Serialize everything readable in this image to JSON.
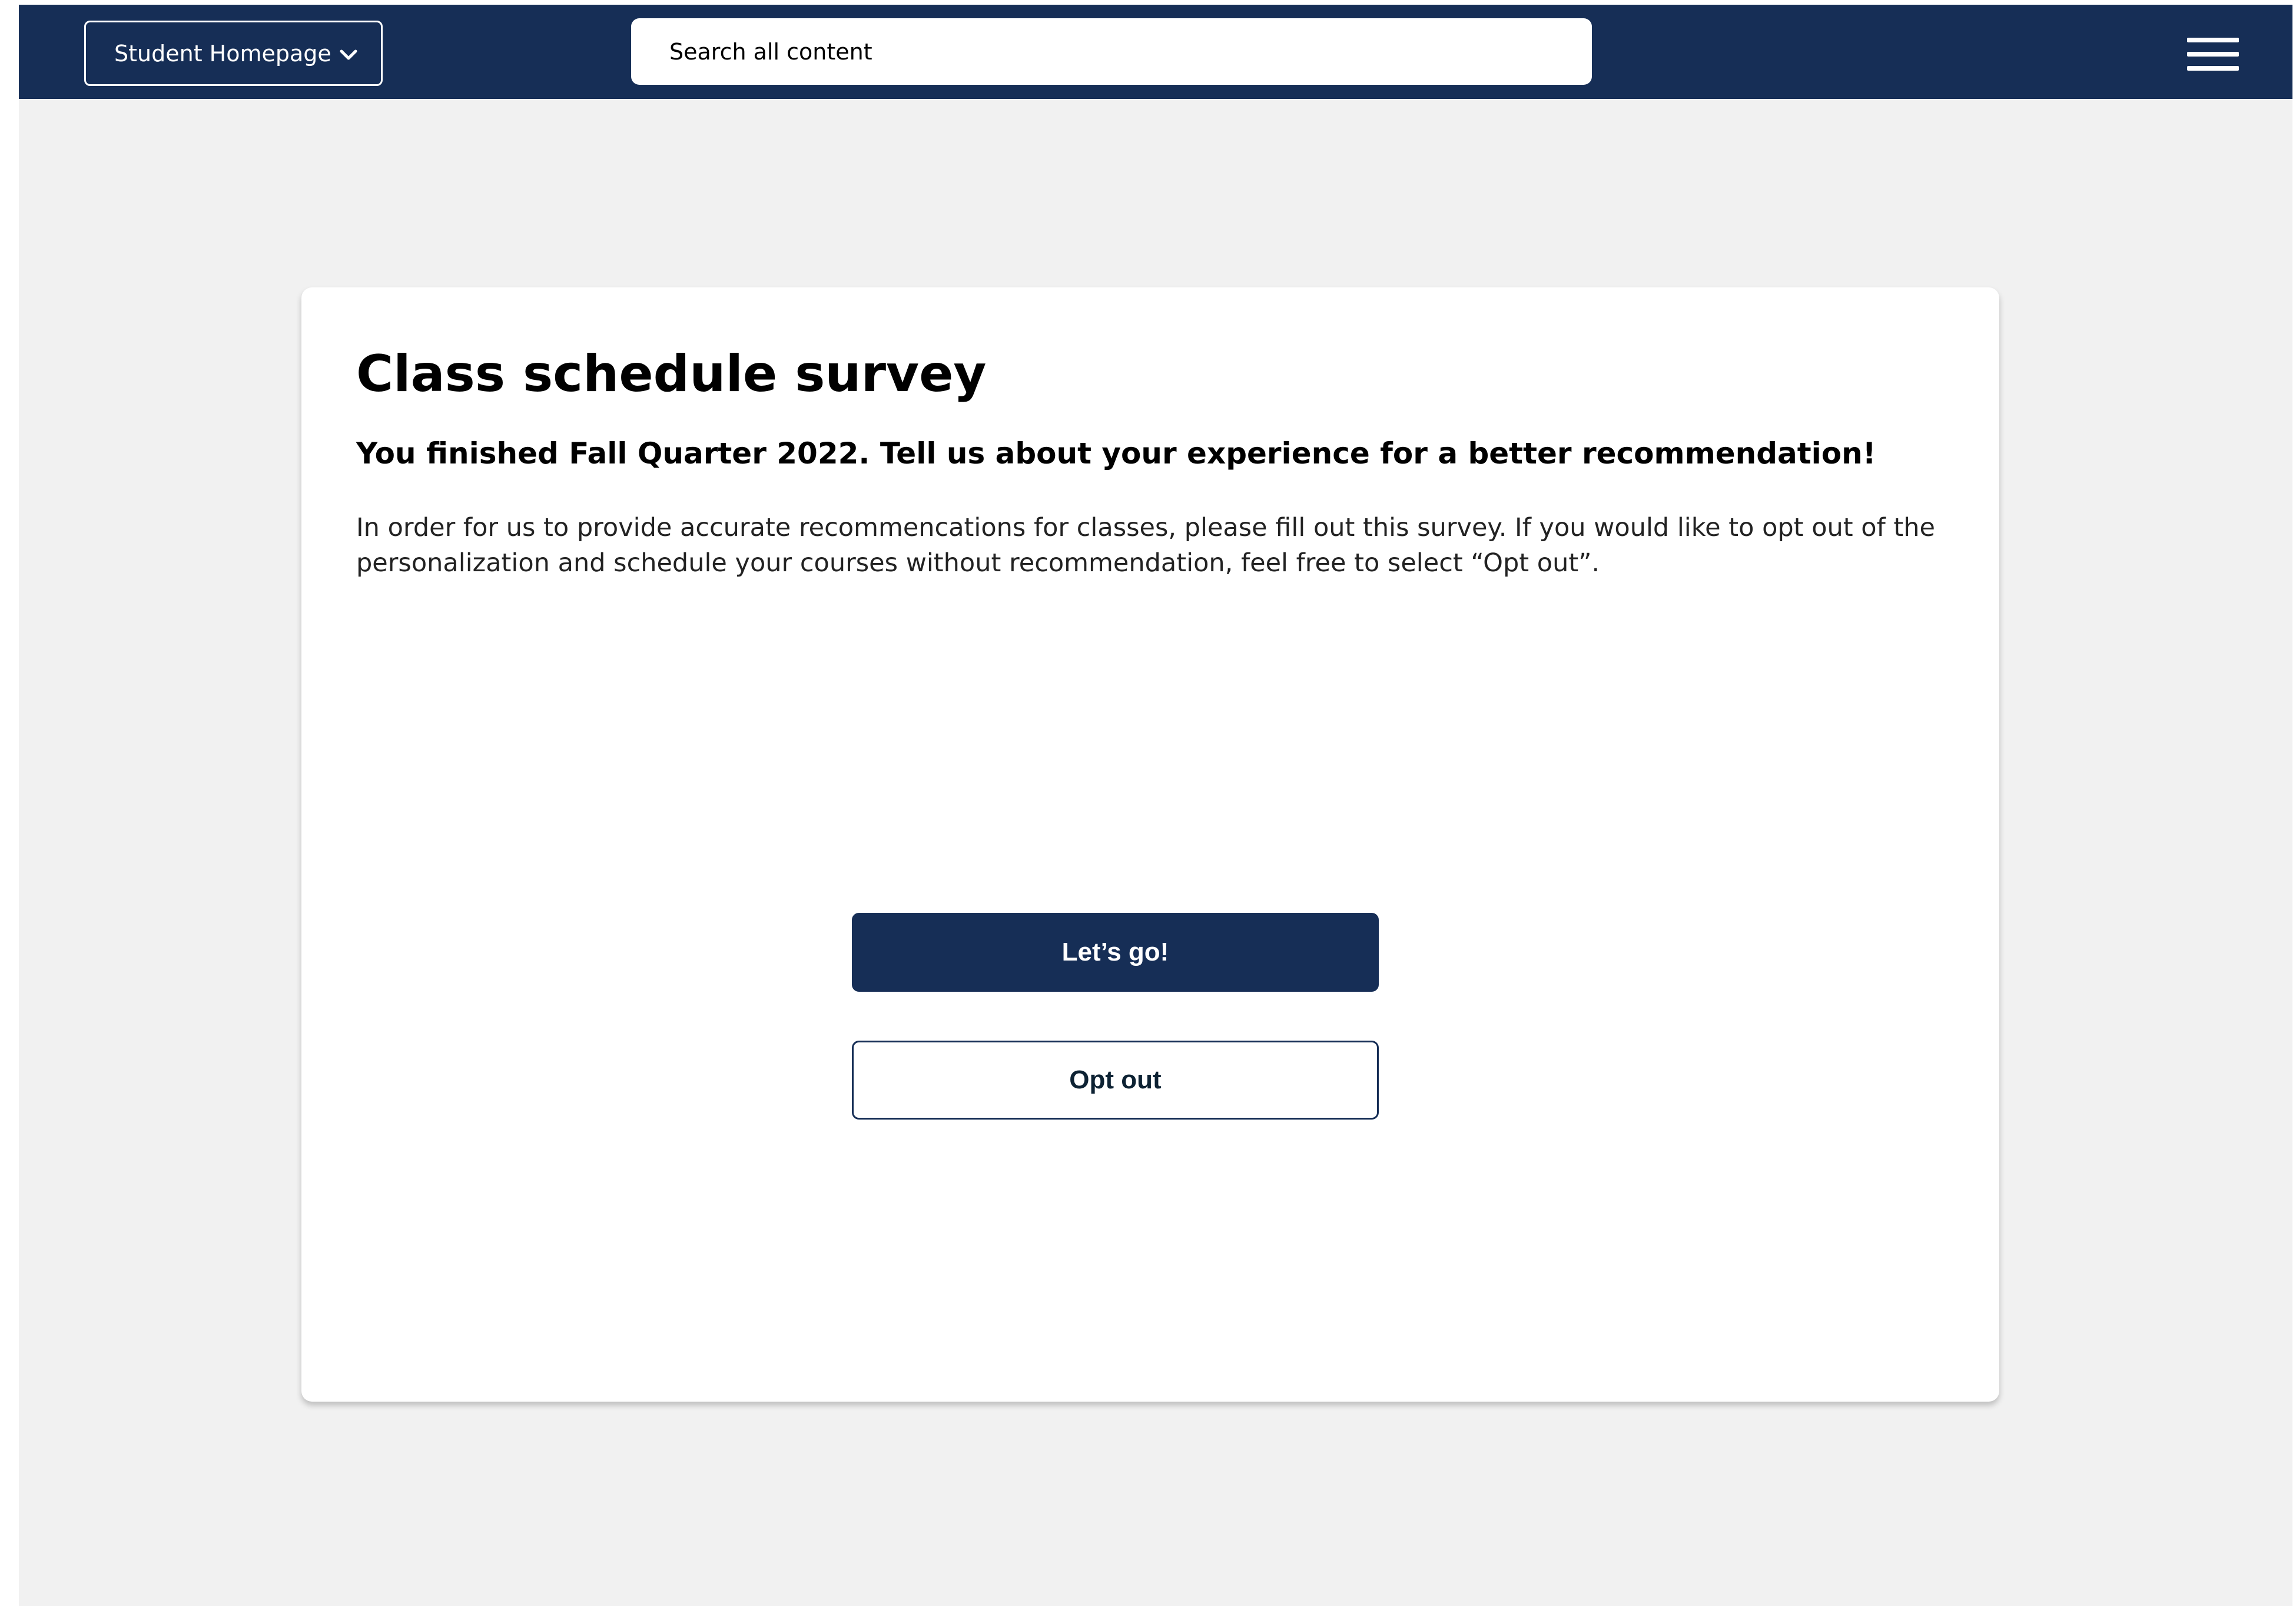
{
  "header": {
    "homepage_select": {
      "label": "Student Homepage",
      "icon": "chevron-down-icon"
    },
    "search": {
      "placeholder": "Search all content"
    },
    "menu_icon": "hamburger-menu-icon"
  },
  "card": {
    "title": "Class schedule survey",
    "subtitle": "You finished Fall Quarter 2022. Tell us about your experience for a better recommendation!",
    "body": "In order for us to provide accurate recommencations for classes, please fill out this survey. If you would like to opt out of the personalization and schedule your courses without recommendation, feel free to select “Opt out”.",
    "primary_button": "Let’s go!",
    "secondary_button": "Opt out"
  },
  "colors": {
    "brand_navy": "#162e56",
    "page_background": "#f1f1f1",
    "card_background": "#ffffff"
  }
}
